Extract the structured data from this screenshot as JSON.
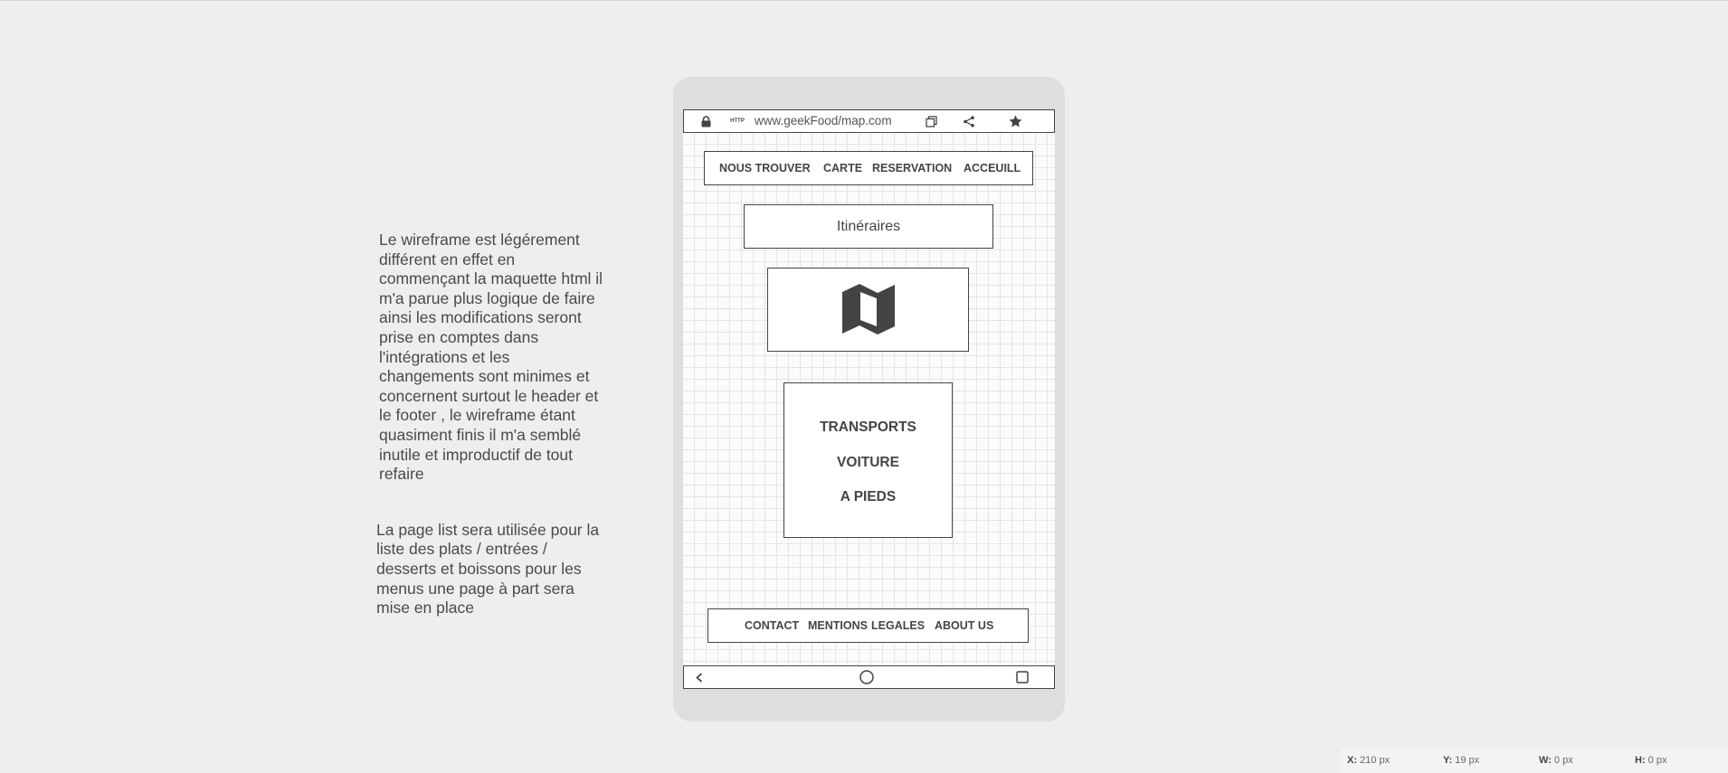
{
  "notes": {
    "paragraph1": "Le wireframe est légérement différent en effet en commençant la maquette html il m'a parue plus logique de faire ainsi les modifications seront prise en comptes dans l'intégrations et les changements sont minimes et concernent surtout le header et le footer , le wireframe étant quasiment finis il m'a semblé inutile et improductif de tout refaire",
    "paragraph2": "La page list sera utilisée pour la liste des plats / entrées / desserts et boissons pour les menus une page à part sera mise en place"
  },
  "browser": {
    "url": "www.geekFood/map.com",
    "icons": [
      "lock-icon",
      "http-icon",
      "tabs-icon",
      "share-icon",
      "star-icon"
    ],
    "http_label": "HTTP"
  },
  "topnav": {
    "items": [
      "NOUS TROUVER",
      "CARTE",
      "RESERVATION",
      "ACCEUILL"
    ]
  },
  "itineraries": {
    "label": "Itinéraires"
  },
  "map": {
    "icon": "map-icon"
  },
  "transport": {
    "options": [
      "TRANSPORTS",
      "VOITURE",
      "A PIEDS"
    ]
  },
  "footer": {
    "items": [
      "CONTACT",
      "MENTIONS",
      "LEGALES",
      "ABOUT US"
    ]
  },
  "android_nav": {
    "icons": [
      "back-icon",
      "home-icon",
      "recents-icon"
    ]
  },
  "statusbar": {
    "x_label": "X:",
    "x_value": "210 px",
    "y_label": "Y:",
    "y_value": "19 px",
    "w_label": "W:",
    "w_value": "0 px",
    "h_label": "H:",
    "h_value": "0 px"
  },
  "colors": {
    "background": "#eeeeee",
    "device": "#dedede",
    "stroke": "#444444"
  }
}
